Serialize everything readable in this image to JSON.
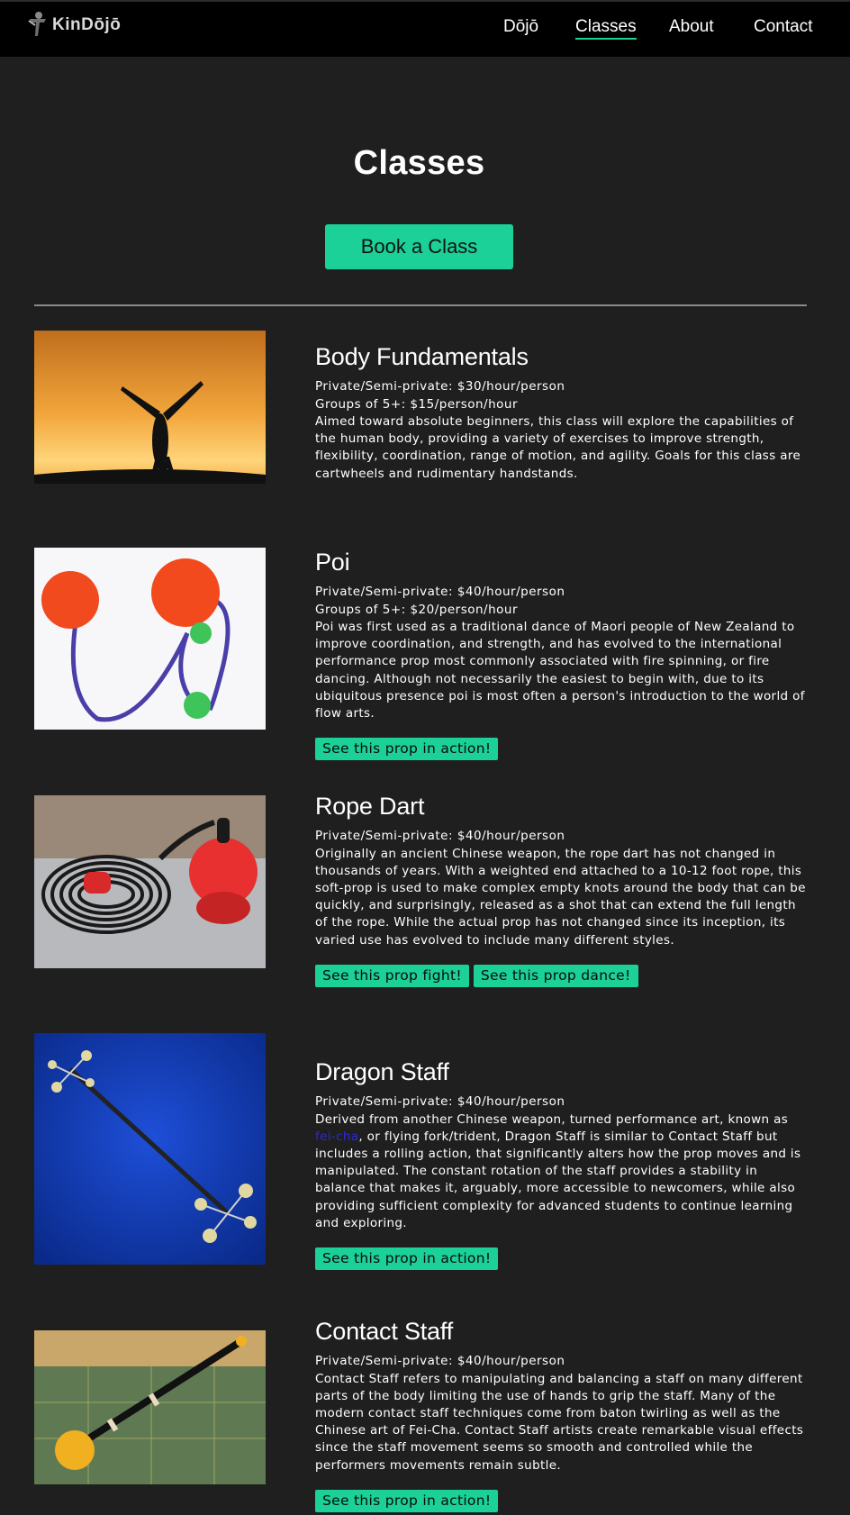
{
  "header": {
    "logo_text": "KinDōjō",
    "nav": [
      {
        "label": "Dōjō"
      },
      {
        "label": "Classes",
        "active": true
      },
      {
        "label": "About"
      },
      {
        "label": "Contact"
      }
    ]
  },
  "page": {
    "title": "Classes",
    "book_button": "Book a Class"
  },
  "classes": [
    {
      "name": "Body Fundamentals",
      "prices": [
        "Private/Semi-private: $30/hour/person",
        "Groups of 5+: $15/person/hour"
      ],
      "description": "Aimed toward absolute beginners, this class will explore the capabilities of the human body, providing a variety of exercises to improve strength, flexibility, coordination, range of motion, and agility. Goals for this class are cartwheels and rudimentary handstands.",
      "image": "handstand-silhouette-sunset-photo"
    },
    {
      "name": "Poi",
      "prices": [
        "Private/Semi-private: $40/hour/person",
        "Groups of 5+: $20/person/hour"
      ],
      "description": "Poi was first used as a traditional dance of Maori people of New Zealand to improve coordination, and strength, and has evolved to the international performance prop most commonly associated with fire spinning, or fire dancing. Although not necessarily the easiest to begin with, due to its ubiquitous presence poi is most often a person's introduction to the world of flow arts.",
      "image": "poi-balls-photo",
      "buttons": [
        "See this prop in action!"
      ]
    },
    {
      "name": "Rope Dart",
      "prices": [
        "Private/Semi-private: $40/hour/person"
      ],
      "description": "Originally an ancient Chinese weapon, the rope dart has not changed in thousands of years. With a weighted end attached to a 10-12 foot rope, this soft-prop is used to make complex empty knots around the body that can be quickly, and surprisingly, released as a shot that can extend the full length of the rope. While the actual prop has not changed since its inception, its varied use has evolved to include many different styles.",
      "image": "rope-dart-photo",
      "buttons": [
        "See this prop fight!",
        "See this prop dance!"
      ]
    },
    {
      "name": "Dragon Staff",
      "prices": [
        "Private/Semi-private: $40/hour/person"
      ],
      "description_before": "Derived from another Chinese weapon, turned performance art, known as ",
      "description_link": "fei-cha",
      "description_after": ", or flying fork/trident, Dragon Staff is similar to Contact Staff but includes a rolling action, that significantly alters how the prop moves and is manipulated. The constant rotation of the staff provides a stability in balance that makes it, arguably, more accessible to newcomers, while also providing sufficient complexity for advanced students to continue learning and exploring.",
      "image": "dragon-staff-photo",
      "buttons": [
        "See this prop in action!"
      ]
    },
    {
      "name": "Contact Staff",
      "prices": [
        "Private/Semi-private: $40/hour/person"
      ],
      "description": "Contact Staff refers to manipulating and balancing a staff on many different parts of the body limiting the use of hands to grip the staff. Many of the modern contact staff techniques come from baton twirling as well as the Chinese art of Fei-Cha. Contact Staff artists create remarkable visual effects since the staff movement seems so smooth and controlled while the performers movements remain subtle.",
      "image": "contact-staff-photo",
      "buttons": [
        "See this prop in action!"
      ]
    }
  ],
  "colors": {
    "background": "#1f1f1f",
    "header": "#000000",
    "accent": "#1bd197",
    "link": "#2b2bd6"
  }
}
